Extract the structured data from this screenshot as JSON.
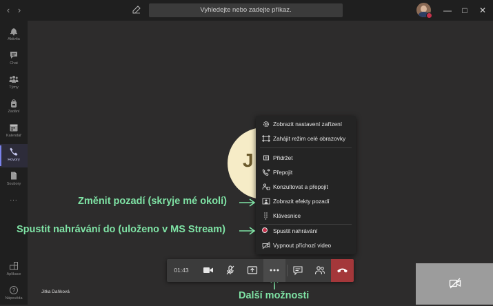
{
  "search": {
    "placeholder": "Vyhledejte nebo zadejte příkaz."
  },
  "sidebar": {
    "items": [
      {
        "label": "Aktivita",
        "icon": "bell-icon"
      },
      {
        "label": "Chat",
        "icon": "chat-icon"
      },
      {
        "label": "Týmy",
        "icon": "teams-icon"
      },
      {
        "label": "Zadání",
        "icon": "backpack-icon"
      },
      {
        "label": "Kalendář",
        "icon": "calendar-icon"
      },
      {
        "label": "Hovory",
        "icon": "phone-icon",
        "active": true
      },
      {
        "label": "Soubory",
        "icon": "files-icon"
      },
      {
        "label": "...",
        "icon": "more-icon"
      }
    ],
    "bottom": [
      {
        "label": "Aplikace",
        "icon": "apps-icon"
      },
      {
        "label": "Nápověda",
        "icon": "help-icon"
      }
    ]
  },
  "call": {
    "avatar_initial": "J",
    "participant_name": "Jitka Daňková",
    "timer": "01:43"
  },
  "menu": {
    "items": [
      {
        "label": "Zobrazit nastavení zařízení",
        "icon": "gear-icon"
      },
      {
        "label": "Zahájit režim celé obrazovky",
        "icon": "fullscreen-icon"
      },
      {
        "label": "Přidržet",
        "icon": "hold-icon"
      },
      {
        "label": "Přepojit",
        "icon": "transfer-icon"
      },
      {
        "label": "Konzultovat a přepojit",
        "icon": "consult-transfer-icon"
      },
      {
        "label": "Zobrazit efekty pozadí",
        "icon": "background-effects-icon"
      },
      {
        "label": "Klávesnice",
        "icon": "dialpad-icon"
      },
      {
        "label": "Spustit nahrávání",
        "icon": "record-icon"
      },
      {
        "label": "Vypnout příchozí video",
        "icon": "video-off-icon"
      }
    ]
  },
  "annotations": {
    "background": "Změnit pozadí (skryje mé okolí)",
    "recording": "Spustit nahrávání do (uloženo v MS Stream)",
    "more": "Další možnosti"
  },
  "colors": {
    "accent": "#7b83eb",
    "annotation": "#7fe3a5",
    "hangup": "#a4373a",
    "recording": "#c4314b"
  }
}
